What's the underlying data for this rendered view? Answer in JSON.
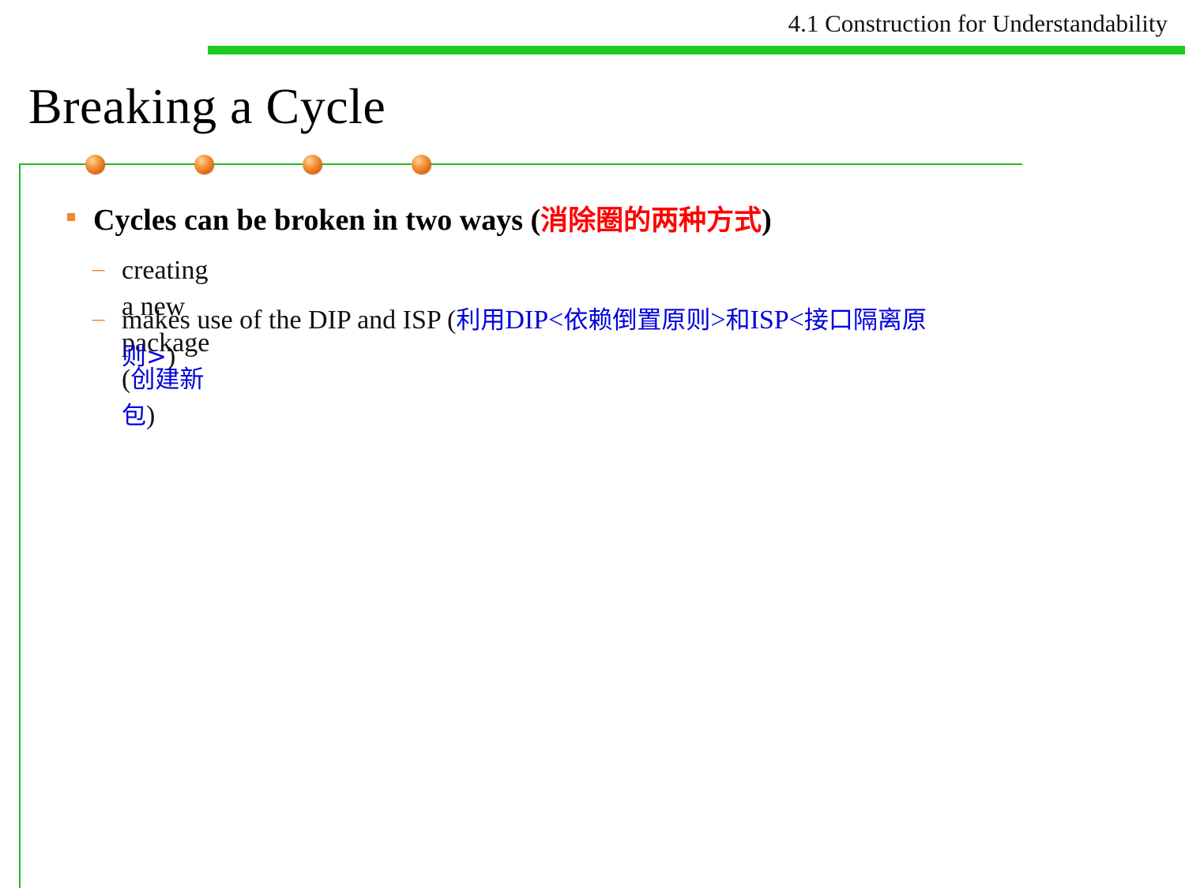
{
  "header": {
    "section": "4.1 Construction for Understandability"
  },
  "slide": {
    "title": "Breaking a Cycle",
    "bullet": {
      "text_en": "Cycles can be broken in two ways (",
      "text_zh": "消除圈的两种方式",
      "text_close": ")"
    },
    "sub_items": [
      {
        "text_en": "creating a new package (",
        "parts": [
          "创建新包"
        ],
        "text_close": ")"
      },
      {
        "text_en": "makes use of the DIP and ISP (",
        "parts": [
          "利用",
          "DIP<",
          "依赖倒置原则",
          ">",
          "和",
          "ISP<",
          "接口隔离原",
          "则>"
        ],
        "text_close": ")"
      }
    ]
  },
  "colors": {
    "header_bar": "#1ecb1e",
    "frame": "#22bb22",
    "accent_orange": "#f4862a",
    "chinese_red": "#ff0000",
    "chinese_blue": "#0000dd"
  }
}
